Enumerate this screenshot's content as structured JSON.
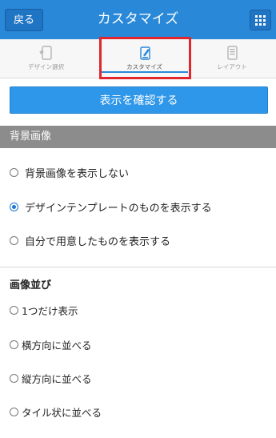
{
  "header": {
    "back_label": "戻る",
    "title": "カスタマイズ",
    "menu_icon": "grid-icon"
  },
  "tabs": [
    {
      "label": "デザイン選択",
      "icon": "design-select-icon",
      "active": false
    },
    {
      "label": "カスタマイズ",
      "icon": "customize-icon",
      "active": true
    },
    {
      "label": "レイアウト",
      "icon": "layout-icon",
      "active": false
    }
  ],
  "confirm_button": "表示を確認する",
  "background_section": {
    "title": "背景画像",
    "options": [
      {
        "label": "背景画像を表示しない",
        "checked": false
      },
      {
        "label": "デザインテンプレートのものを表示する",
        "checked": true
      },
      {
        "label": "自分で用意したものを表示する",
        "checked": false
      }
    ]
  },
  "arrangement_section": {
    "title": "画像並び",
    "options": [
      {
        "label": "1つだけ表示",
        "checked": false
      },
      {
        "label": "横方向に並べる",
        "checked": false
      },
      {
        "label": "縦方向に並べる",
        "checked": false
      },
      {
        "label": "タイル状に並べる",
        "checked": false
      }
    ]
  },
  "colors": {
    "header": "#2a88d8",
    "button": "#2f97ea",
    "section_bar": "#8c8c8c",
    "highlight": "#e1262e"
  }
}
